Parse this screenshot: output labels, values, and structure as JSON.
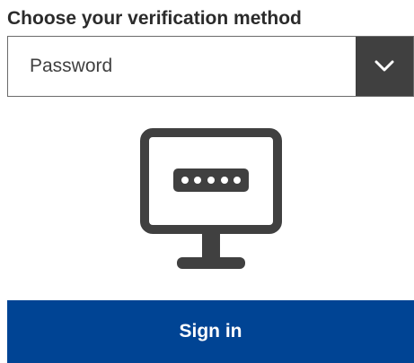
{
  "form": {
    "heading": "Choose your verification method",
    "method_select": {
      "selected": "Password",
      "arrow_icon": "chevron-down-icon"
    },
    "illustration_icon": "monitor-password-icon",
    "signin_label": "Sign in"
  },
  "colors": {
    "primary_button": "#004494",
    "select_arrow_bg": "#404040",
    "icon": "#404040"
  }
}
